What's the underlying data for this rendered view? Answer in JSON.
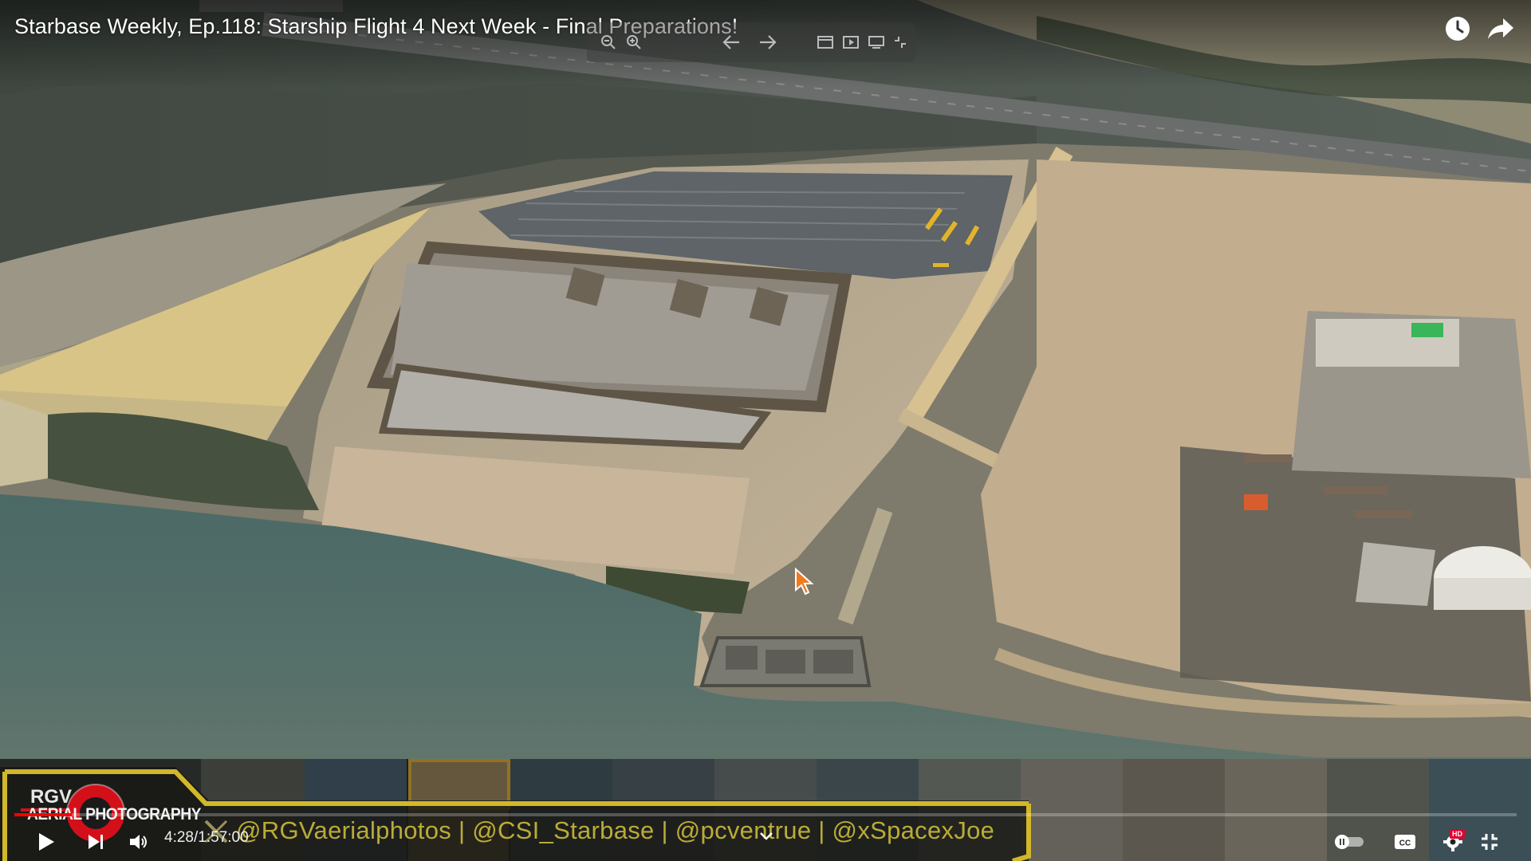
{
  "video": {
    "title": "Starbase Weekly, Ep.118: Starship Flight 4 Next Week - Final Preparations!",
    "current_time": "4:28",
    "separator": " / ",
    "duration": "1:57:00",
    "progress": 0.038
  },
  "top_actions": {
    "watch_later_icon": "clock-icon",
    "share_icon": "share-arrow-icon"
  },
  "viewer_toolbar": {
    "icons": [
      "zoom-out-icon",
      "zoom-in-icon",
      "back-arrow-icon",
      "forward-arrow-icon",
      "window-icon",
      "play-window-icon",
      "display-icon",
      "collapse-icon"
    ]
  },
  "overlay": {
    "logo_line1": "RGV",
    "logo_line2": "AERIAL PHOTOGRAPHY",
    "social_handles": "@RGVaerialphotos | @CSI_Starbase | @pcventrue | @xSpacexJoe"
  },
  "controls": {
    "play_icon": "play-icon",
    "next_icon": "next-icon",
    "volume_icon": "volume-icon",
    "autoplay_icon": "autoplay-toggle-icon",
    "captions_icon": "cc-icon",
    "settings_icon": "gear-icon",
    "settings_badge": "HD",
    "fullscreen_icon": "fullscreen-icon"
  },
  "colors": {
    "progress": "#ff0000",
    "overlay_gold": "#d6c43c",
    "hd_badge": "#e1002d"
  }
}
